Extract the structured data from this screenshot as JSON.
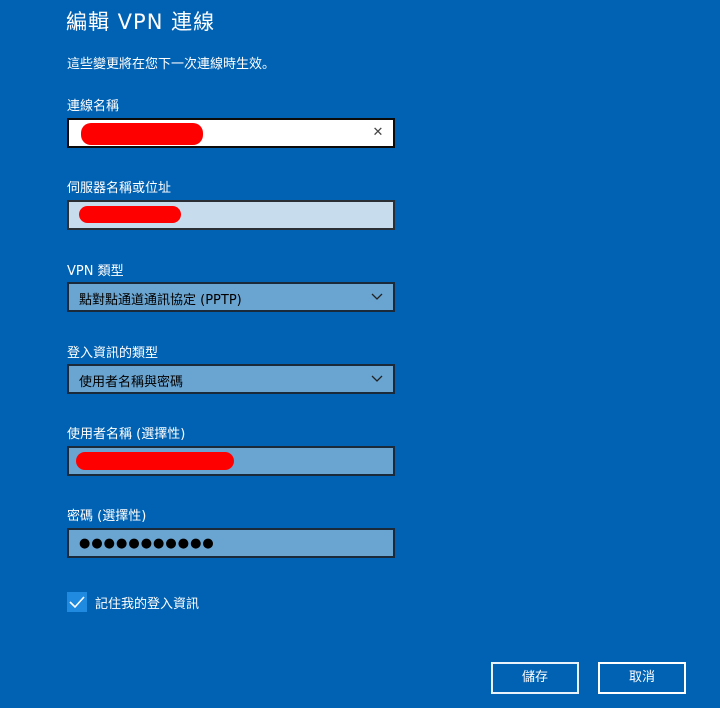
{
  "header": {
    "title": "編輯 VPN 連線",
    "subtitle": "這些變更將在您下一次連線時生效。"
  },
  "fields": {
    "connection_name": {
      "label": "連線名稱",
      "value": ""
    },
    "server_address": {
      "label": "伺服器名稱或位址",
      "value": ""
    },
    "vpn_type": {
      "label": "VPN 類型",
      "selected": "點對點通道通訊協定 (PPTP)"
    },
    "signin_type": {
      "label": "登入資訊的類型",
      "selected": "使用者名稱與密碼"
    },
    "username": {
      "label": "使用者名稱 (選擇性)",
      "value": ""
    },
    "password": {
      "label": "密碼 (選擇性)",
      "masked": "●●●●●●●●●●●"
    }
  },
  "remember": {
    "label": "記住我的登入資訊",
    "checked": true
  },
  "buttons": {
    "save": "儲存",
    "cancel": "取消"
  },
  "icons": {
    "clear": "close-icon",
    "dropdown": "chevron-down-icon",
    "check": "checkmark-icon"
  },
  "colors": {
    "background": "#0162b3",
    "redaction": "#ff0000",
    "checkbox": "#1f8ae0"
  }
}
